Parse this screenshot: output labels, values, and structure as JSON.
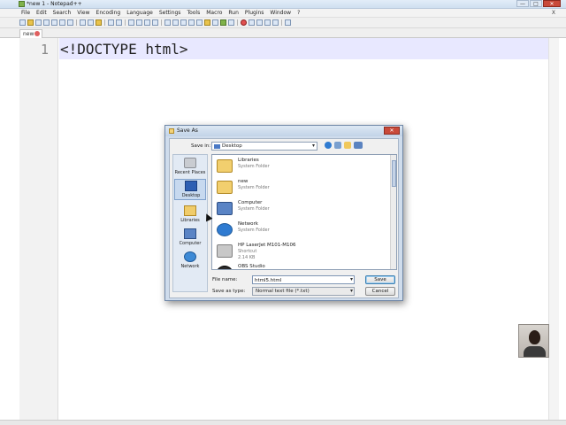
{
  "window": {
    "title": "*new 1 - Notepad++",
    "controls": [
      "—",
      "□",
      "✕"
    ]
  },
  "menu": {
    "items": [
      "File",
      "Edit",
      "Search",
      "View",
      "Encoding",
      "Language",
      "Settings",
      "Tools",
      "Macro",
      "Run",
      "Plugins",
      "Window",
      "?"
    ],
    "close_glyph": "X"
  },
  "tab": {
    "label": "new 1"
  },
  "editor": {
    "line_number": "1",
    "code": "<!DOCTYPE html>"
  },
  "dialog": {
    "title": "Save As",
    "close_glyph": "✕",
    "save_in_label": "Save in:",
    "save_in_value": "Desktop",
    "places": [
      {
        "label": "Recent Places",
        "icon": "recent-places-icon"
      },
      {
        "label": "Desktop",
        "icon": "desktop-icon"
      },
      {
        "label": "Libraries",
        "icon": "libraries-icon"
      },
      {
        "label": "Computer",
        "icon": "computer-icon"
      },
      {
        "label": "Network",
        "icon": "network-icon"
      }
    ],
    "files": [
      {
        "name": "Libraries",
        "type": "System Folder",
        "size": "",
        "icon": "libraries-folder-icon"
      },
      {
        "name": "new",
        "type": "System Folder",
        "size": "",
        "icon": "user-folder-icon"
      },
      {
        "name": "Computer",
        "type": "System Folder",
        "size": "",
        "icon": "computer-icon"
      },
      {
        "name": "Network",
        "type": "System Folder",
        "size": "",
        "icon": "network-icon"
      },
      {
        "name": "HP LaserJet M101-M106",
        "type": "Shortcut",
        "size": "2.14 KB",
        "icon": "printer-icon"
      },
      {
        "name": "OBS Studio",
        "type": "",
        "size": "",
        "icon": "obs-icon"
      }
    ],
    "filename_label": "File name:",
    "filename_value": "html5.html",
    "savetype_label": "Save as type:",
    "savetype_value": "Normal text file (*.txt)",
    "save_button": "Save",
    "cancel_button": "Cancel",
    "selected_place": "Desktop"
  },
  "colors": {
    "current_line_highlight": "#e8e8ff",
    "dialog_frame": "#cfdcec",
    "close_button": "#c94a3a"
  }
}
